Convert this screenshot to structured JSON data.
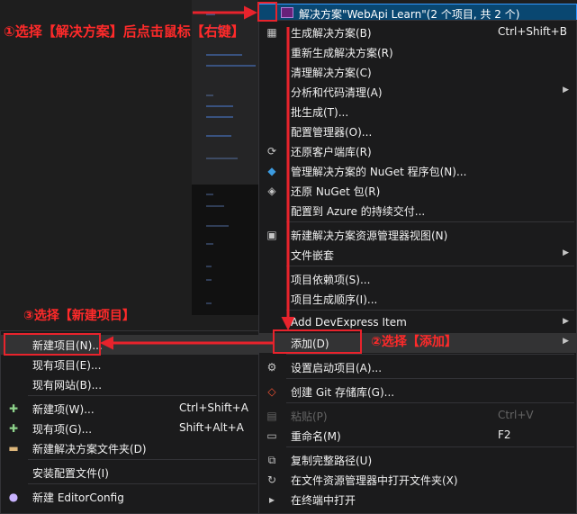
{
  "solution": {
    "label": "解决方案\"WebApi Learn\"(2 个项目, 共 2 个)"
  },
  "main_menu": [
    {
      "label": "生成解决方案(B)",
      "shortcut": "Ctrl+Shift+B",
      "icon": "build-icon"
    },
    {
      "label": "重新生成解决方案(R)"
    },
    {
      "label": "清理解决方案(C)"
    },
    {
      "label": "分析和代码清理(A)",
      "submenu": true
    },
    {
      "label": "批生成(T)..."
    },
    {
      "label": "配置管理器(O)..."
    },
    {
      "label": "还原客户端库(R)",
      "icon": "restore-icon"
    },
    {
      "label": "管理解决方案的 NuGet 程序包(N)...",
      "icon": "nuget-icon"
    },
    {
      "label": "还原 NuGet 包(R)",
      "icon": "nuget-restore-icon"
    },
    {
      "label": "配置到 Azure 的持续交付..."
    },
    {
      "label": "新建解决方案资源管理器视图(N)",
      "icon": "new-view-icon"
    },
    {
      "label": "文件嵌套",
      "submenu": true
    },
    {
      "label": "项目依赖项(S)..."
    },
    {
      "label": "项目生成顺序(I)..."
    },
    {
      "label": "Add DevExpress Item",
      "submenu": true
    },
    {
      "label": "添加(D)",
      "submenu": true,
      "highlighted": true
    },
    {
      "label": "设置启动项目(A)...",
      "icon": "gear-icon"
    },
    {
      "label": "创建 Git 存储库(G)...",
      "icon": "git-icon"
    },
    {
      "label": "粘贴(P)",
      "shortcut": "Ctrl+V",
      "disabled": true,
      "icon": "paste-icon"
    },
    {
      "label": "重命名(M)",
      "shortcut": "F2",
      "icon": "rename-icon"
    },
    {
      "label": "复制完整路径(U)",
      "icon": "copy-path-icon"
    },
    {
      "label": "在文件资源管理器中打开文件夹(X)",
      "icon": "open-folder-icon"
    },
    {
      "label": "在终端中打开",
      "icon": "terminal-icon"
    }
  ],
  "sub_menu": [
    {
      "label": "新建项目(N)...",
      "highlighted": true
    },
    {
      "label": "现有项目(E)..."
    },
    {
      "label": "现有网站(B)..."
    },
    {
      "label": "新建项(W)...",
      "shortcut": "Ctrl+Shift+A",
      "icon": "new-item-icon"
    },
    {
      "label": "现有项(G)...",
      "shortcut": "Shift+Alt+A",
      "icon": "existing-item-icon"
    },
    {
      "label": "新建解决方案文件夹(D)",
      "icon": "solution-folder-icon"
    },
    {
      "label": "安装配置文件(I)"
    },
    {
      "label": "新建 EditorConfig",
      "icon": "editorconfig-icon"
    }
  ],
  "annotations": {
    "step1": "①选择【解决方案】后点击鼠标【右键】",
    "step2": "②选择【添加】",
    "step3": "③选择【新建项目】"
  },
  "colors": {
    "annotation": "#e8232c",
    "selection": "#094771",
    "menu_bg": "#1b1b1c"
  }
}
